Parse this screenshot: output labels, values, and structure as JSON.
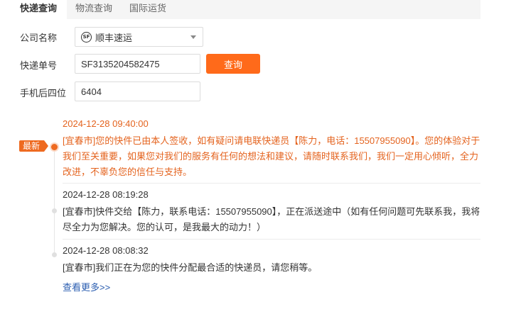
{
  "tabs": [
    {
      "label": "快递查询",
      "active": true
    },
    {
      "label": "物流查询",
      "active": false
    },
    {
      "label": "国际运货",
      "active": false
    }
  ],
  "form": {
    "company_label": "公司名称",
    "company_value": "顺丰速运",
    "company_logo_text": "SF",
    "tracking_label": "快递单号",
    "tracking_value": "SF3135204582475",
    "phone_label": "手机后四位",
    "phone_value": "6404",
    "query_button": "查询"
  },
  "timeline": {
    "latest_badge": "最新",
    "entries": [
      {
        "time": "2024-12-28 09:40:00",
        "message": "[宜春市]您的快件已由本人签收，如有疑问请电联快递员【陈力，电话：15507955090】。您的体验对于我们至关重要，如果您对我们的服务有任何的想法和建议，请随时联系我们，我们一定用心倾听，全力改进，不辜负您的信任与支持。",
        "latest": true
      },
      {
        "time": "2024-12-28 08:19:28",
        "message": "[宜春市]快件交给【陈力，联系电话：15507955090】，正在派送途中（如有任何问题可先联系我，我将尽全力为您解决。您的认可，是我最大的动力！）",
        "latest": false
      },
      {
        "time": "2024-12-28 08:08:32",
        "message": "[宜春市]我们正在为您的快件分配最合适的快递员，请您稍等。",
        "latest": false
      }
    ],
    "more_link": "查看更多>>"
  },
  "colors": {
    "accent": "#ff6a1a",
    "latest_text": "#e4631e",
    "link": "#2a5db0"
  }
}
